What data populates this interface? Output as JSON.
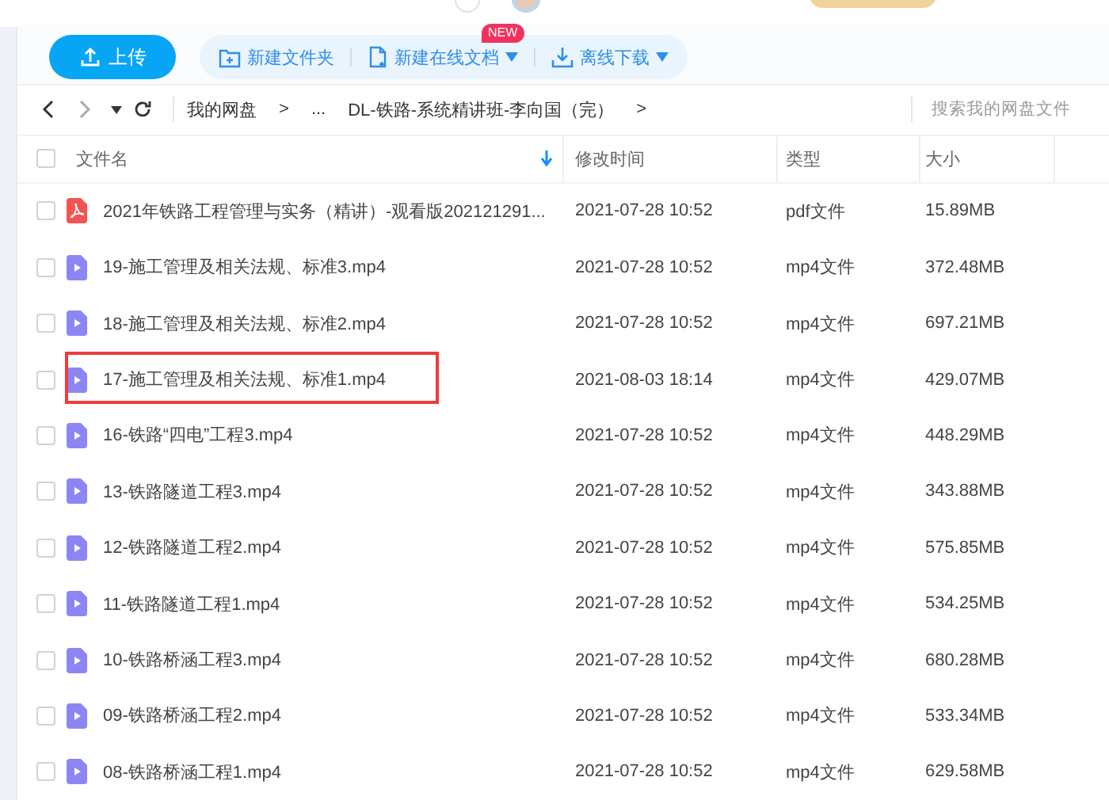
{
  "toolbar": {
    "upload": "上传",
    "actions": [
      {
        "label": "新建文件夹",
        "kind": "folder",
        "dropdown": false
      },
      {
        "label": "新建在线文档",
        "kind": "doc",
        "dropdown": true,
        "badge": "NEW"
      },
      {
        "label": "离线下载",
        "kind": "download",
        "dropdown": true
      }
    ]
  },
  "breadcrumb": {
    "items": [
      "我的网盘",
      ">",
      "...",
      "DL-铁路-系统精讲班-李向国（完）",
      ">"
    ]
  },
  "search": {
    "placeholder": "搜索我的网盘文件"
  },
  "table": {
    "all_checked": false,
    "columns": [
      "文件名",
      "修改时间",
      "类型",
      "大小"
    ],
    "rows": [
      {
        "name": "2021年铁路工程管理与实务（精讲）-观看版202121291...",
        "kind": "pdf",
        "modified": "2021-07-28 10:52",
        "type": "pdf文件",
        "size": "15.89MB",
        "checked": false,
        "annotated": false
      },
      {
        "name": "19-施工管理及相关法规、标准3.mp4",
        "kind": "video",
        "modified": "2021-07-28 10:52",
        "type": "mp4文件",
        "size": "372.48MB",
        "checked": false,
        "annotated": false
      },
      {
        "name": "18-施工管理及相关法规、标准2.mp4",
        "kind": "video",
        "modified": "2021-07-28 10:52",
        "type": "mp4文件",
        "size": "697.21MB",
        "checked": false,
        "annotated": false
      },
      {
        "name": "17-施工管理及相关法规、标准1.mp4",
        "kind": "video",
        "modified": "2021-08-03 18:14",
        "type": "mp4文件",
        "size": "429.07MB",
        "checked": false,
        "annotated": true
      },
      {
        "name": "16-铁路“四电”工程3.mp4",
        "kind": "video",
        "modified": "2021-07-28 10:52",
        "type": "mp4文件",
        "size": "448.29MB",
        "checked": false,
        "annotated": false
      },
      {
        "name": "13-铁路隧道工程3.mp4",
        "kind": "video",
        "modified": "2021-07-28 10:52",
        "type": "mp4文件",
        "size": "343.88MB",
        "checked": false,
        "annotated": false
      },
      {
        "name": "12-铁路隧道工程2.mp4",
        "kind": "video",
        "modified": "2021-07-28 10:52",
        "type": "mp4文件",
        "size": "575.85MB",
        "checked": false,
        "annotated": false
      },
      {
        "name": "11-铁路隧道工程1.mp4",
        "kind": "video",
        "modified": "2021-07-28 10:52",
        "type": "mp4文件",
        "size": "534.25MB",
        "checked": false,
        "annotated": false
      },
      {
        "name": "10-铁路桥涵工程3.mp4",
        "kind": "video",
        "modified": "2021-07-28 10:52",
        "type": "mp4文件",
        "size": "680.28MB",
        "checked": false,
        "annotated": false
      },
      {
        "name": "09-铁路桥涵工程2.mp4",
        "kind": "video",
        "modified": "2021-07-28 10:52",
        "type": "mp4文件",
        "size": "533.34MB",
        "checked": false,
        "annotated": false
      },
      {
        "name": "08-铁路桥涵工程1.mp4",
        "kind": "video",
        "modified": "2021-07-28 10:52",
        "type": "mp4文件",
        "size": "629.58MB",
        "checked": false,
        "annotated": false
      }
    ]
  }
}
